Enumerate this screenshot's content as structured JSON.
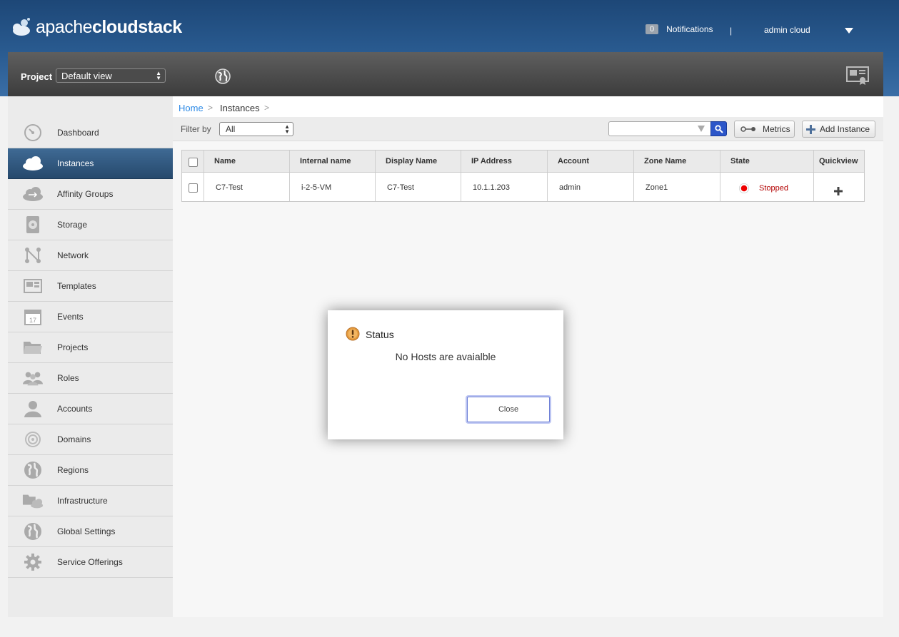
{
  "header": {
    "logo_prefix": "apache",
    "logo_suffix": "cloudstack",
    "notifications_count": "0",
    "notifications_label": "Notifications",
    "separator": "|",
    "user_name": "admin cloud"
  },
  "navbar": {
    "project_label": "Project",
    "project_value": "Default view"
  },
  "sidebar": {
    "items": [
      {
        "label": "Dashboard",
        "icon": "dashboard-icon"
      },
      {
        "label": "Instances",
        "icon": "cloud-icon",
        "active": true
      },
      {
        "label": "Affinity Groups",
        "icon": "affinity-icon"
      },
      {
        "label": "Storage",
        "icon": "storage-icon"
      },
      {
        "label": "Network",
        "icon": "network-icon"
      },
      {
        "label": "Templates",
        "icon": "templates-icon"
      },
      {
        "label": "Events",
        "icon": "calendar-icon"
      },
      {
        "label": "Projects",
        "icon": "folder-icon"
      },
      {
        "label": "Roles",
        "icon": "roles-icon"
      },
      {
        "label": "Accounts",
        "icon": "user-icon"
      },
      {
        "label": "Domains",
        "icon": "domains-icon"
      },
      {
        "label": "Regions",
        "icon": "globe-icon"
      },
      {
        "label": "Infrastructure",
        "icon": "infrastructure-icon"
      },
      {
        "label": "Global Settings",
        "icon": "settings-globe-icon"
      },
      {
        "label": "Service Offerings",
        "icon": "gear-icon"
      }
    ],
    "events_day": "17"
  },
  "breadcrumb": {
    "home": "Home",
    "separator": ">",
    "current": "Instances"
  },
  "toolbar": {
    "filter_label": "Filter by",
    "filter_value": "All",
    "metrics_label": "Metrics",
    "add_label": "Add Instance"
  },
  "table": {
    "columns": [
      "Name",
      "Internal name",
      "Display Name",
      "IP Address",
      "Account",
      "Zone Name",
      "State",
      "Quickview"
    ],
    "rows": [
      {
        "name": "C7-Test",
        "internal_name": "i-2-5-VM",
        "display_name": "C7-Test",
        "ip_address": "10.1.1.203",
        "account": "admin",
        "zone_name": "Zone1",
        "state": "Stopped"
      }
    ]
  },
  "dialog": {
    "title": "Status",
    "message": "No Hosts are avaialble",
    "close_label": "Close"
  },
  "colors": {
    "header_blue": "#2b5d93",
    "link_blue": "#2d8ae6",
    "stopped_red": "#b30000",
    "active_nav": "#325a82"
  }
}
